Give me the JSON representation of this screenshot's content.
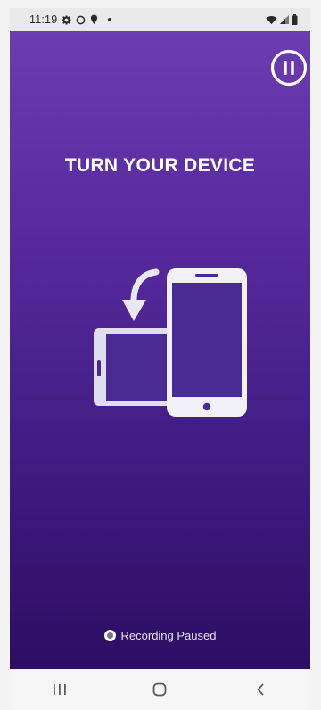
{
  "status_bar": {
    "time": "11:19",
    "icons_left": [
      "settings-icon",
      "circle-icon",
      "location-icon",
      "dot-icon"
    ],
    "icons_right": [
      "wifi-icon",
      "signal-icon",
      "battery-icon"
    ]
  },
  "app": {
    "title": "TURN YOUR DEVICE",
    "illustration": "rotate-device-illustration",
    "recording_status": "Recording Paused",
    "pause_icon": "pause-icon",
    "colors": {
      "gradient_top": "#6b3db0",
      "gradient_bottom": "#2c0e63",
      "illustration": "#e9e7f2"
    }
  },
  "nav_bar": {
    "icons": [
      "recent-apps-icon",
      "home-icon",
      "back-icon"
    ]
  }
}
